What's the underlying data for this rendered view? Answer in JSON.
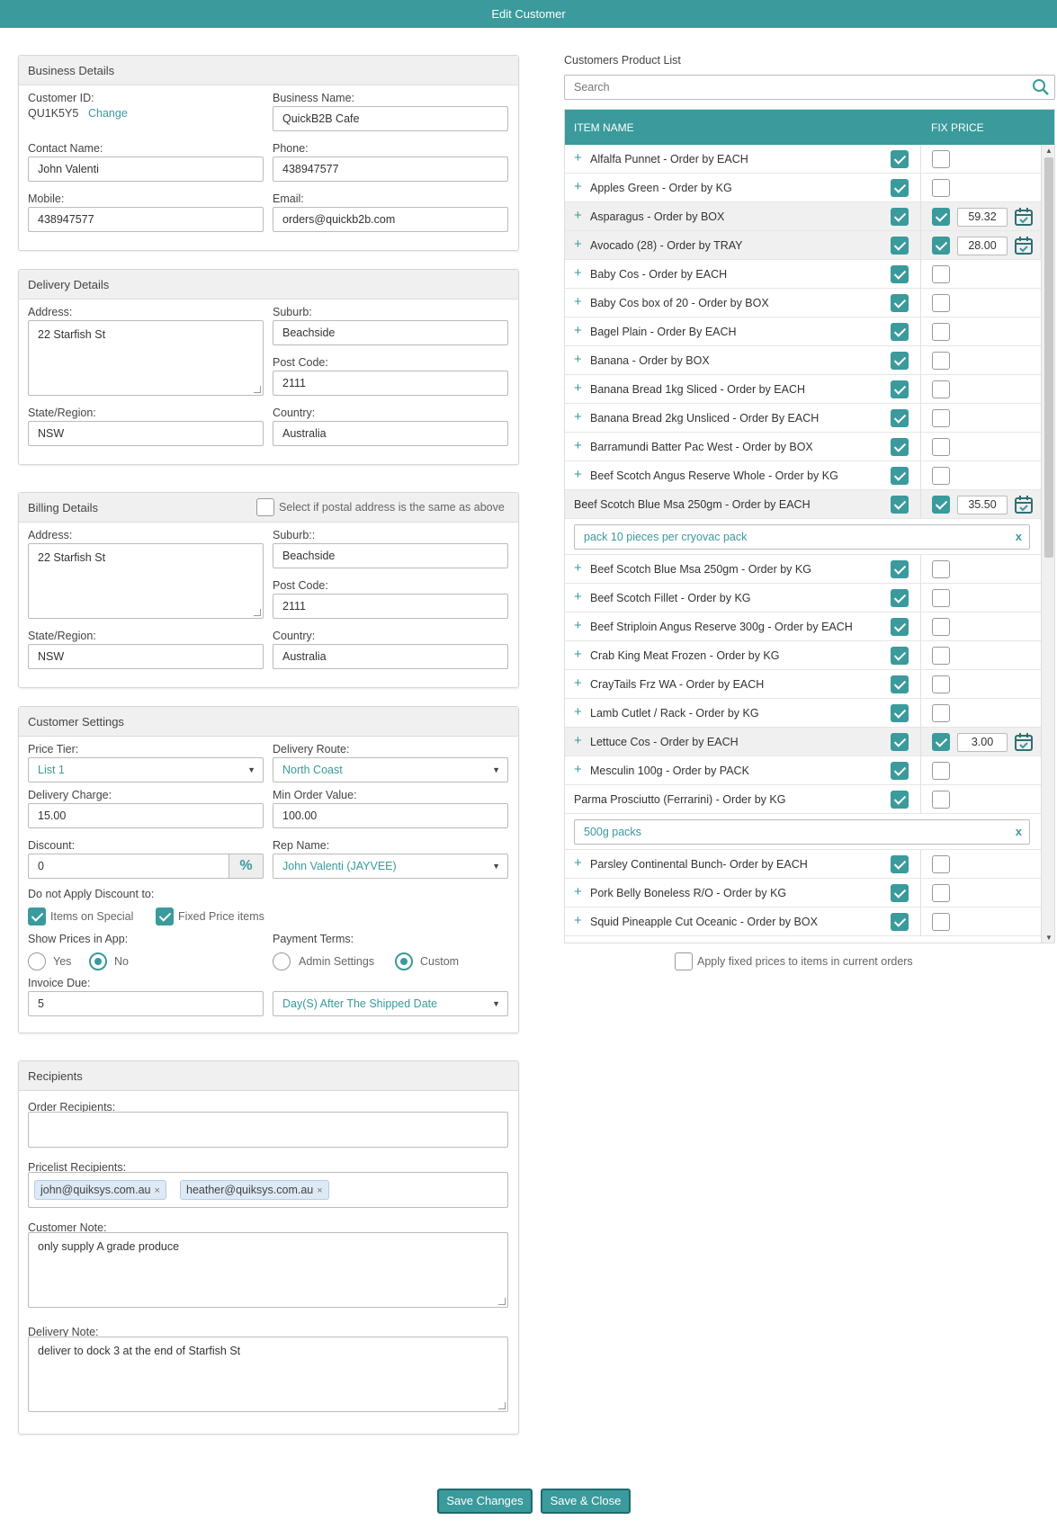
{
  "window": {
    "title": "Edit Customer"
  },
  "business": {
    "heading": "Business Details",
    "customer_id_label": "Customer ID:",
    "customer_id": "QU1K5Y5",
    "change_link": "Change",
    "business_name_label": "Business Name:",
    "business_name": "QuickB2B Cafe",
    "contact_name_label": "Contact Name:",
    "contact_name": "John Valenti",
    "phone_label": "Phone:",
    "phone": "438947577",
    "mobile_label": "Mobile:",
    "mobile": "438947577",
    "email_label": "Email:",
    "email": "orders@quickb2b.com"
  },
  "delivery": {
    "heading": "Delivery Details",
    "address_label": "Address:",
    "address": "22 Starfish St",
    "suburb_label": "Suburb:",
    "suburb": "Beachside",
    "postcode_label": "Post Code:",
    "postcode": "2111",
    "state_label": "State/Region:",
    "state": "NSW",
    "country_label": "Country:",
    "country": "Australia"
  },
  "billing": {
    "heading": "Billing Details",
    "same_as_label": "Select if postal address is the same as above",
    "address_label": "Address:",
    "address": "22 Starfish St",
    "suburb_label": "Suburb::",
    "suburb": "Beachside",
    "postcode_label": "Post Code:",
    "postcode": "2111",
    "state_label": "State/Region:",
    "state": "NSW",
    "country_label": "Country:",
    "country": "Australia"
  },
  "settings": {
    "heading": "Customer Settings",
    "price_tier_label": "Price Tier:",
    "price_tier": "List 1",
    "delivery_route_label": "Delivery Route:",
    "delivery_route": "North Coast",
    "delivery_charge_label": "Delivery Charge:",
    "delivery_charge": "15.00",
    "min_order_label": "Min Order Value:",
    "min_order": "100.00",
    "discount_label": "Discount:",
    "discount": "0",
    "percent": "%",
    "rep_name_label": "Rep Name:",
    "rep_name": "John Valenti (JAYVEE)",
    "no_discount_label": "Do not Apply Discount to:",
    "items_special": "Items on Special",
    "fixed_price_items": "Fixed Price items",
    "show_prices_label": "Show Prices in App:",
    "yes": "Yes",
    "no": "No",
    "payment_terms_label": "Payment Terms:",
    "admin_settings": "Admin Settings",
    "custom": "Custom",
    "invoice_due_label": "Invoice Due:",
    "invoice_due": "5",
    "invoice_due_unit": "Day(S) After The Shipped Date"
  },
  "recipients": {
    "heading": "Recipients",
    "order_label": "Order Recipients:",
    "pricelist_label": "Pricelist Recipients:",
    "pricelist": [
      "john@quiksys.com.au",
      "heather@quiksys.com.au"
    ],
    "chip_remove": "×",
    "customer_note_label": "Customer Note:",
    "customer_note": "only supply A grade produce",
    "delivery_note_label": "Delivery Note:",
    "delivery_note": "deliver to dock 3 at the end of Starfish St"
  },
  "products": {
    "heading": "Customers Product List",
    "search_placeholder": "Search",
    "col_item": "ITEM NAME",
    "col_fix": "FIX PRICE",
    "note_clear": "x",
    "rows": [
      {
        "name": "Alfalfa Punnet - Order by EACH",
        "plus": true,
        "fixed": false
      },
      {
        "name": "Apples Green - Order by KG",
        "plus": true,
        "fixed": false
      },
      {
        "name": "Asparagus - Order by BOX",
        "plus": true,
        "fixed": true,
        "price": "59.32"
      },
      {
        "name": "Avocado (28) - Order by TRAY",
        "plus": true,
        "fixed": true,
        "price": "28.00"
      },
      {
        "name": "Baby Cos - Order by EACH",
        "plus": true,
        "fixed": false
      },
      {
        "name": "Baby Cos box of 20 - Order by BOX",
        "plus": true,
        "fixed": false
      },
      {
        "name": "Bagel Plain - Order By EACH",
        "plus": true,
        "fixed": false
      },
      {
        "name": "Banana - Order by BOX",
        "plus": true,
        "fixed": false
      },
      {
        "name": "Banana Bread 1kg Sliced - Order by EACH",
        "plus": true,
        "fixed": false
      },
      {
        "name": "Banana Bread 2kg Unsliced - Order By EACH",
        "plus": true,
        "fixed": false
      },
      {
        "name": "Barramundi Batter Pac West - Order by BOX",
        "plus": true,
        "fixed": false
      },
      {
        "name": "Beef Scotch Angus Reserve Whole - Order by KG",
        "plus": true,
        "fixed": false
      },
      {
        "name": "Beef Scotch Blue Msa 250gm - Order by EACH",
        "plus": false,
        "fixed": true,
        "price": "35.50",
        "note": "pack 10 pieces per cryovac pack"
      },
      {
        "name": "Beef Scotch Blue Msa 250gm - Order by KG",
        "plus": true,
        "fixed": false
      },
      {
        "name": "Beef Scotch Fillet - Order by KG",
        "plus": true,
        "fixed": false
      },
      {
        "name": "Beef Striploin Angus Reserve 300g - Order by EACH",
        "plus": true,
        "fixed": false
      },
      {
        "name": "Crab King Meat Frozen - Order by KG",
        "plus": true,
        "fixed": false
      },
      {
        "name": "CrayTails Frz WA - Order by EACH",
        "plus": true,
        "fixed": false
      },
      {
        "name": "Lamb Cutlet / Rack - Order by KG",
        "plus": true,
        "fixed": false
      },
      {
        "name": "Lettuce Cos - Order by EACH",
        "plus": true,
        "fixed": true,
        "price": "3.00"
      },
      {
        "name": "Mesculin 100g - Order by PACK",
        "plus": true,
        "fixed": false
      },
      {
        "name": "Parma Prosciutto (Ferrarini) - Order by KG",
        "plus": false,
        "fixed": false,
        "note": "500g packs"
      },
      {
        "name": "Parsley Continental Bunch- Order by EACH",
        "plus": true,
        "fixed": false
      },
      {
        "name": "Pork Belly Boneless R/O - Order by KG",
        "plus": true,
        "fixed": false
      },
      {
        "name": "Squid Pineapple Cut Oceanic - Order by BOX",
        "plus": true,
        "fixed": false
      }
    ],
    "apply_fixed_label": "Apply fixed prices to items in current orders"
  },
  "footer": {
    "save_changes": "Save Changes",
    "save_close": "Save & Close"
  },
  "colors": {
    "accent": "#3a9a9c"
  }
}
